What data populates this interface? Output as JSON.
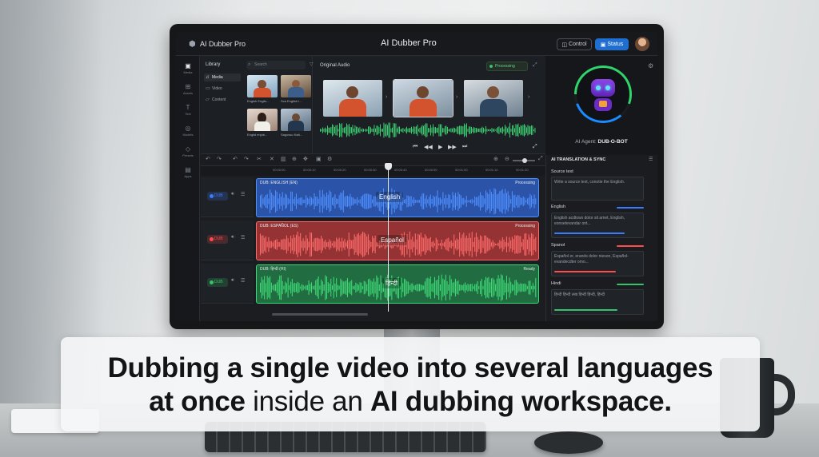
{
  "app": {
    "title": "AI Dubber Pro",
    "title_small": "AI Dubber Pro",
    "control_label": "Control",
    "status_label": "Status"
  },
  "rail": {
    "items": [
      {
        "label": "Media",
        "icon": "media-icon"
      },
      {
        "label": "Assets",
        "icon": "assets-icon"
      },
      {
        "label": "Text",
        "icon": "text-icon"
      },
      {
        "label": "Models",
        "icon": "models-icon"
      },
      {
        "label": "Presets",
        "icon": "presets-icon"
      },
      {
        "label": "Apps",
        "icon": "apps-icon"
      }
    ]
  },
  "library": {
    "title": "Library",
    "search_placeholder": "Search",
    "nav": [
      {
        "label": "Media",
        "active": true
      },
      {
        "label": "Video",
        "active": false
      },
      {
        "label": "Content",
        "active": false
      }
    ],
    "thumbs": [
      {
        "caption": "Engish Englis..."
      },
      {
        "caption": "Sca English i..."
      },
      {
        "caption": "Engist enjob..."
      },
      {
        "caption": "Sagosso Nati..."
      }
    ]
  },
  "original_audio": {
    "title": "Original Audio",
    "status": "Processing"
  },
  "agent": {
    "label_prefix": "AI Agent:",
    "name": "DUB-O-BOT"
  },
  "timeline": {
    "ticks": [
      "00:00:00",
      "00:00:10",
      "00:00:20",
      "00:00:30",
      "00:00:40",
      "00:00:50",
      "00:01:00",
      "00:01:10",
      "00:01:20",
      "00:01:30"
    ],
    "tracks": [
      {
        "chip": "DUB",
        "clip_name": "DUB: ENGLISH (EN)",
        "state": "Processing",
        "label": "English",
        "color": "#2f62c9",
        "wave": "#4f90ff",
        "chip_color": "#3b7cff"
      },
      {
        "chip": "DUB",
        "clip_name": "DUB: ESPAÑOL (ES)",
        "state": "Processing",
        "label": "Español",
        "color": "#b43a3a",
        "wave": "#ff6b6b",
        "chip_color": "#ff4d4d"
      },
      {
        "chip": "DUB",
        "clip_name": "DUB: हिन्दी (HI)",
        "state": "Ready",
        "label": "हिन्दी",
        "color": "#23814a",
        "wave": "#3fdb78",
        "chip_color": "#35c26b"
      }
    ]
  },
  "translation": {
    "title": "AI TRANSLATION & SYNC",
    "source_label": "Source text",
    "source_placeholder": "Write a source text, conotie the English.",
    "langs": [
      {
        "name": "English",
        "text": "English acdtows dolor sit amet, English, eonsetevandar ont...",
        "color": "#3b7cff",
        "progress": 0.8
      },
      {
        "name": "Spanol",
        "text": "Español er, erands dolor nieson, Español-evandecdter omo...",
        "color": "#ff4d4d",
        "progress": 0.7
      },
      {
        "name": "Hindi",
        "text": "हिन्दी हिन्दी लख हिन्दी हिन्दी, हिन्दी",
        "color": "#35c26b",
        "progress": 0.72
      }
    ]
  },
  "caption": {
    "line1": "Dubbing a single video into several languages",
    "line2_bold1": "at once",
    "line2_normal": " inside an ",
    "line2_bold2": "AI dubbing workspace."
  }
}
